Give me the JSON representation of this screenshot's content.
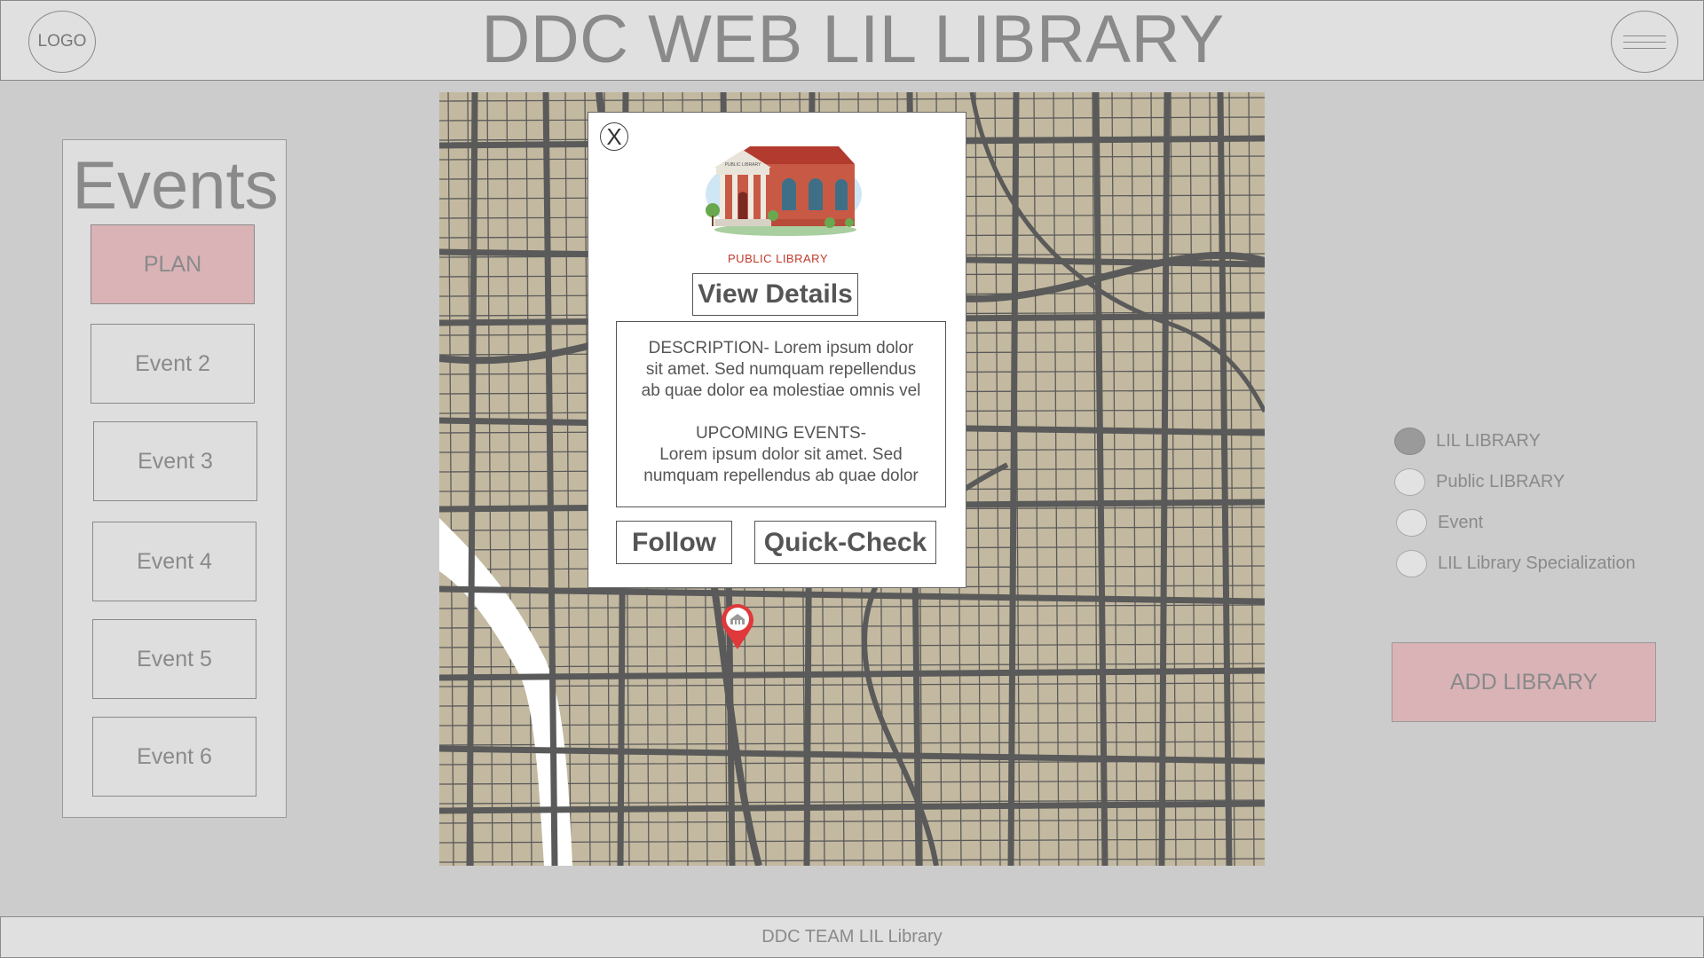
{
  "header": {
    "logo_label": "LOGO",
    "title": "DDC WEB LIL LIBRARY"
  },
  "events": {
    "title": "Events",
    "items": [
      "PLAN",
      "Event 2",
      "Event 3",
      "Event 4",
      "Event 5",
      "Event 6"
    ]
  },
  "popup": {
    "close_label": "X",
    "image_caption": "PUBLIC LIBRARY",
    "image_sign": "PUBLIC LIBRARY",
    "view_details_label": "View Details",
    "description_lines": [
      "DESCRIPTION- Lorem ipsum dolor",
      "sit amet. Sed numquam repellendus",
      "ab quae dolor ea molestiae omnis vel"
    ],
    "upcoming_lines": [
      "UPCOMING EVENTS-",
      "Lorem ipsum dolor sit amet. Sed",
      "numquam repellendus ab quae dolor"
    ],
    "follow_label": "Follow",
    "quick_check_label": "Quick-Check"
  },
  "legend": {
    "items": [
      {
        "label": "LIL LIBRARY",
        "selected": true
      },
      {
        "label": "Public LIBRARY",
        "selected": false
      },
      {
        "label": "Event",
        "selected": false
      },
      {
        "label": "LIL Library Specialization",
        "selected": false
      }
    ]
  },
  "add_library_label": "ADD LIBRARY",
  "footer": {
    "text": "DDC TEAM LIL Library"
  },
  "colors": {
    "background": "#cccccc",
    "header": "#e0e0e0",
    "accent_button": "#d9b3b6",
    "map_land": "#c3b9a0",
    "map_road": "#5a5a5a",
    "pin": "#e0383b"
  }
}
